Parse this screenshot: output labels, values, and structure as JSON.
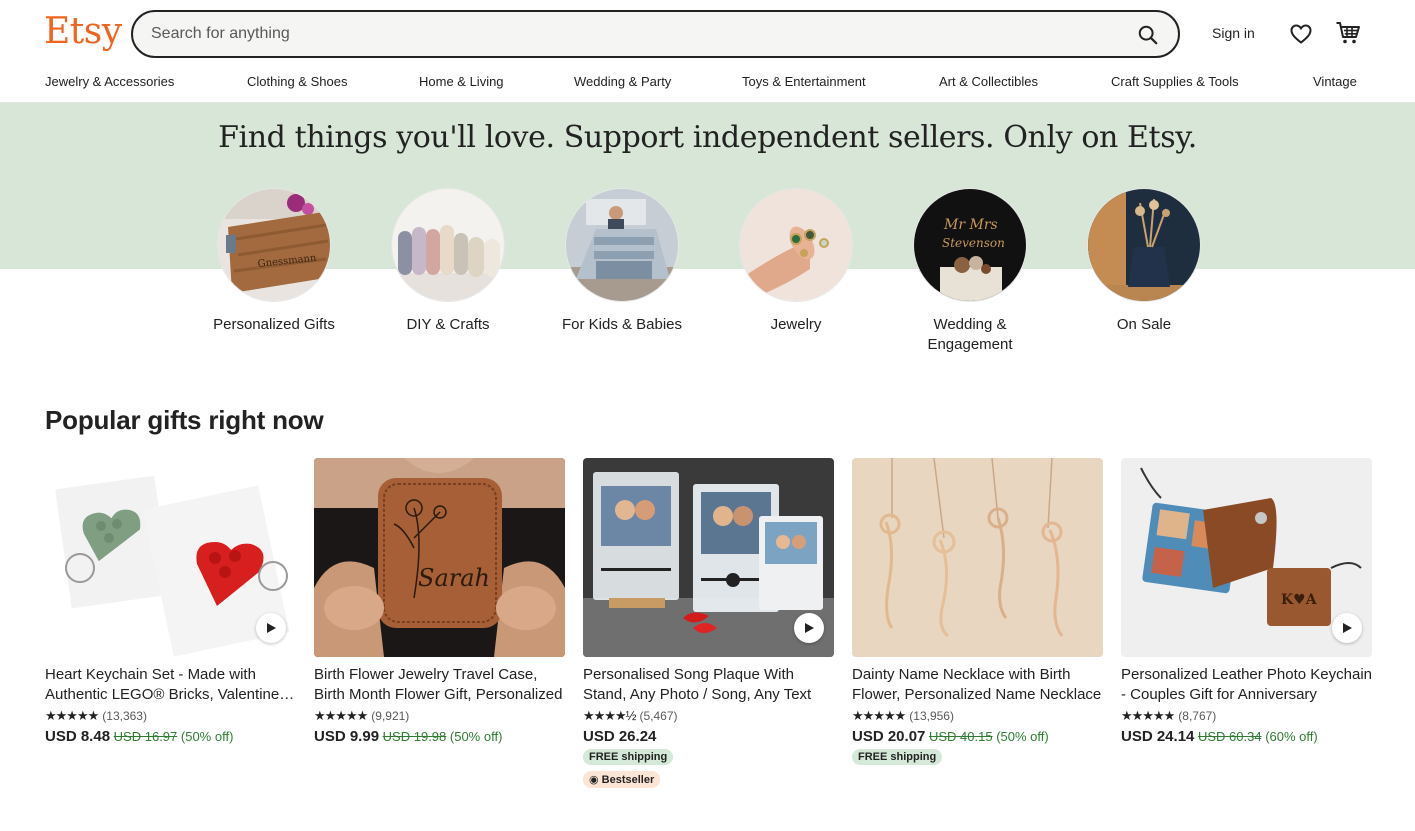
{
  "brand": {
    "logo": "Etsy",
    "accent": "#f1641e",
    "hero_bg": "#d7e6d6",
    "sale_green": "#2e7d32"
  },
  "search": {
    "placeholder": "Search for anything"
  },
  "header": {
    "signin": "Sign in"
  },
  "categories": [
    "Jewelry & Accessories",
    "Clothing & Shoes",
    "Home & Living",
    "Wedding & Party",
    "Toys & Entertainment",
    "Art & Collectibles",
    "Craft Supplies & Tools",
    "Vintage"
  ],
  "hero": {
    "title": "Find things you'll love. Support independent sellers. Only on Etsy."
  },
  "circles": [
    {
      "label": "Personalized Gifts"
    },
    {
      "label": "DIY & Crafts"
    },
    {
      "label": "For Kids & Babies"
    },
    {
      "label": "Jewelry"
    },
    {
      "label": "Wedding & Engagement"
    },
    {
      "label": "On Sale"
    }
  ],
  "popular": {
    "title": "Popular gifts right now",
    "items": [
      {
        "title": "Heart Keychain Set - Made with Authentic LEGO® Bricks, Valentine's Gift for Couples",
        "stars": "★★★★★",
        "reviews": "(13,363)",
        "price": "USD 8.48",
        "original": "USD 16.97",
        "discount": "(50% off)"
      },
      {
        "title": "Birth Flower Jewelry Travel Case, Birth Month Flower Gift, Personalized",
        "stars": "★★★★★",
        "reviews": "(9,921)",
        "price": "USD 9.99",
        "original": "USD 19.98",
        "discount": "(50% off)"
      },
      {
        "title": "Personalised Song Plaque With Stand, Any Photo / Song, Any Text",
        "stars": "★★★★½",
        "reviews": "(5,467)",
        "price": "USD 26.24",
        "shipping": "FREE shipping",
        "bestseller": "Bestseller"
      },
      {
        "title": "Dainty Name Necklace with Birth Flower, Personalized Name Necklace",
        "stars": "★★★★★",
        "reviews": "(13,956)",
        "price": "USD 20.07",
        "original": "USD 40.15",
        "discount": "(50% off)",
        "shipping": "FREE shipping"
      },
      {
        "title": "Personalized Leather Photo Keychain - Couples Gift for Anniversary",
        "stars": "★★★★★",
        "reviews": "(8,767)",
        "price": "USD 24.14",
        "original": "USD 60.34",
        "discount": "(60% off)"
      }
    ]
  }
}
